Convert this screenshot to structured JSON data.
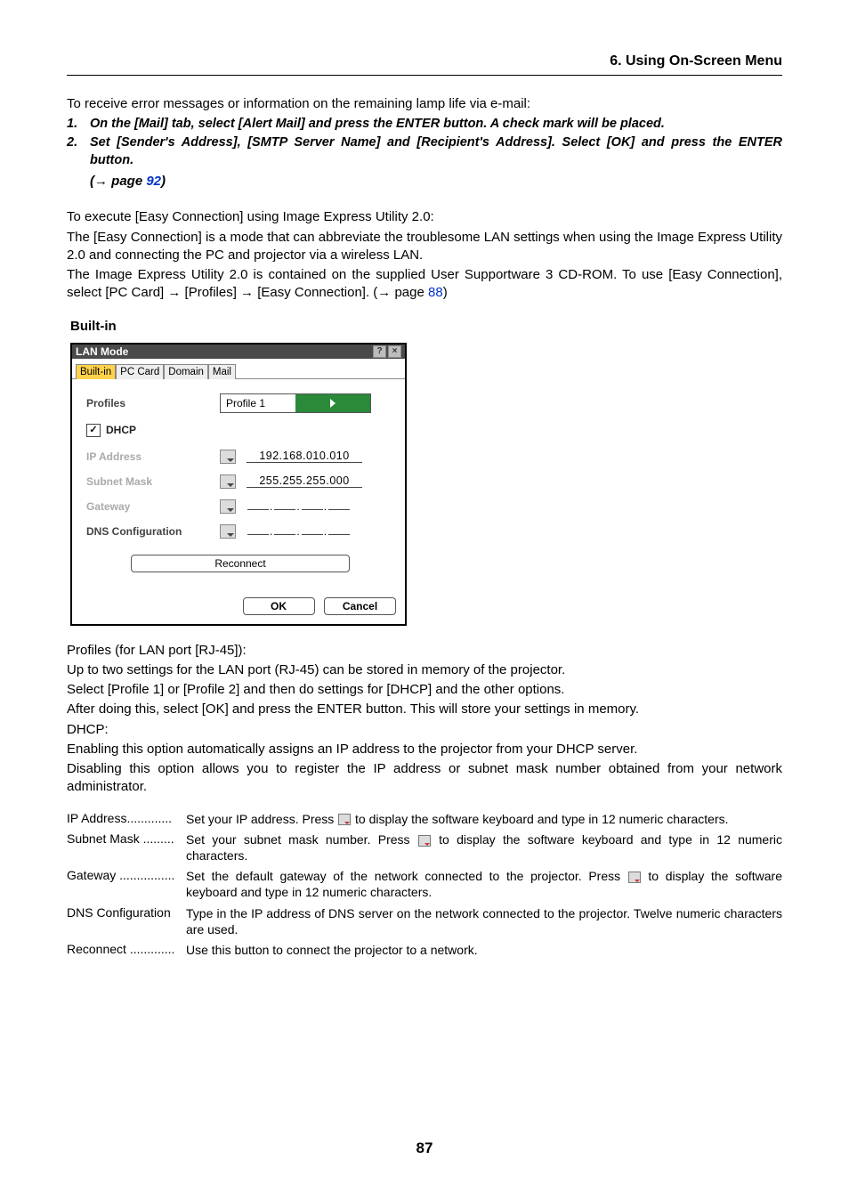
{
  "header": "6. Using On-Screen Menu",
  "intro1": "To receive error messages or information on the remaining lamp life via e-mail:",
  "steps": [
    "On the [Mail] tab, select [Alert Mail] and press the ENTER button. A check mark will be placed.",
    "Set [Sender's Address], [SMTP Server Name] and [Recipient's Address]. Select [OK] and press the ENTER button."
  ],
  "pageref_prefix": "(→ page ",
  "pageref_num": "92",
  "pageref_suffix": ")",
  "para2a": "To execute [Easy Connection] using Image Express Utility 2.0:",
  "para2b": "The [Easy Connection] is a mode that can abbreviate the troublesome LAN settings when using the Image Express Utility 2.0 and connecting the PC and projector via a wireless LAN.",
  "para2c_pre": "The Image Express Utility 2.0 is contained on the supplied User Supportware 3 CD-ROM. To use [Easy Connection], select [PC Card] → [Profiles] → [Easy Connection]. (→ page ",
  "para2c_link": "88",
  "para2c_post": ")",
  "builtin_heading": "Built-in",
  "dialog": {
    "title": "LAN Mode",
    "tabs": [
      "Built-in",
      "PC Card",
      "Domain",
      "Mail"
    ],
    "labels": {
      "profiles": "Profiles",
      "dhcp": "DHCP",
      "ip": "IP Address",
      "subnet": "Subnet Mask",
      "gateway": "Gateway",
      "dns": "DNS Configuration"
    },
    "values": {
      "profile": "Profile 1",
      "ip": "192.168.010.010",
      "subnet": "255.255.255.000"
    },
    "buttons": {
      "reconnect": "Reconnect",
      "ok": "OK",
      "cancel": "Cancel"
    }
  },
  "para3a": "Profiles (for LAN port [RJ-45]):",
  "para3b": "Up to two settings for the LAN port (RJ-45) can be stored in memory of the projector.",
  "para3c": "Select [Profile 1] or [Profile 2] and then do settings for [DHCP] and the other options.",
  "para3d": "After doing this, select [OK] and press the ENTER button. This will store your settings in memory.",
  "para4a": "DHCP:",
  "para4b": "Enabling this option automatically assigns an IP address to the projector from your DHCP server.",
  "para4c": "Disabling this option allows you to register the IP address or subnet mask number obtained from your network administrator.",
  "defs": {
    "ip_term": "IP Address",
    "ip_dots": ".............",
    "ip_desc_a": "Set your IP address. Press ",
    "ip_desc_b": " to display the software keyboard and type in 12 numeric characters.",
    "subnet_term": "Subnet Mask",
    "subnet_dots": ".........",
    "subnet_desc_a": "Set your subnet mask number. Press ",
    "subnet_desc_b": " to display the software keyboard and type in 12 numeric characters.",
    "gw_term": "Gateway",
    "gw_dots": "................",
    "gw_desc_a": "Set the default gateway of the network connected to the projector. Press ",
    "gw_desc_b": " to display the software keyboard and type in 12 numeric characters.",
    "dns_term": "DNS Configuration",
    "dns_desc": "Type in the IP address of DNS server on the network connected to the projector. Twelve numeric characters are used.",
    "rec_term": "Reconnect",
    "rec_dots": ".............",
    "rec_desc": "Use this button to connect the projector to a network."
  },
  "page_number": "87"
}
